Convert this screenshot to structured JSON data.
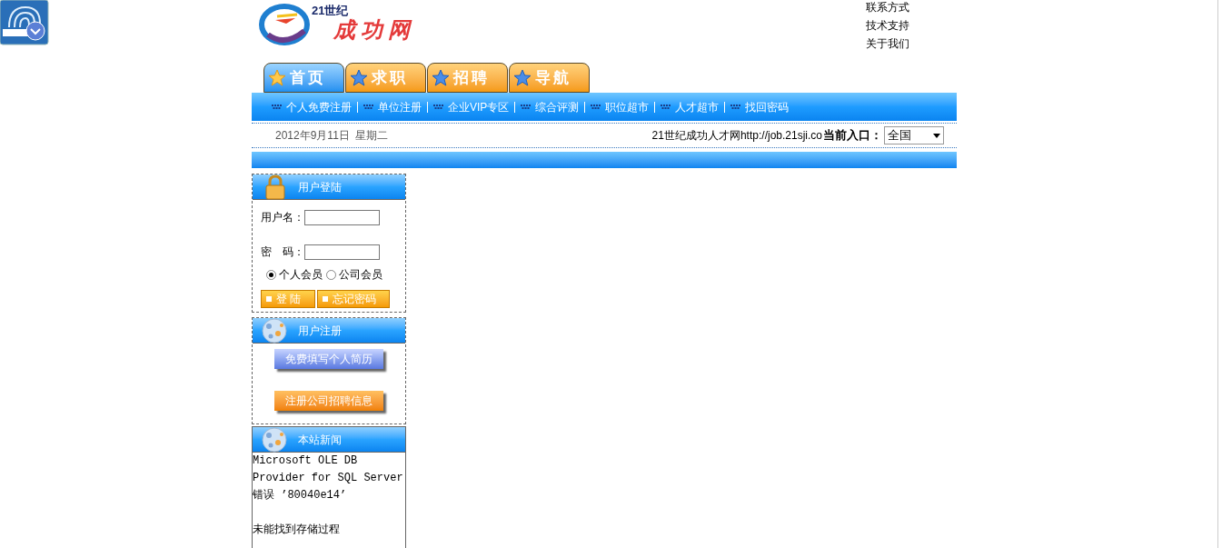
{
  "logo": {
    "top": "21世纪",
    "main": "成功网"
  },
  "header_links": [
    "联系方式",
    "技术支持",
    "关于我们"
  ],
  "tabs": [
    {
      "label": "首页",
      "selected": true
    },
    {
      "label": "求职",
      "selected": false
    },
    {
      "label": "招聘",
      "selected": false
    },
    {
      "label": "导航",
      "selected": false
    }
  ],
  "nav_links": [
    "个人免费注册",
    "单位注册",
    "企业VIP专区",
    "综合评测",
    "职位超市",
    "人才超市",
    "找回密码"
  ],
  "date": "2012年9月11日  星期二",
  "site": "21世纪成功人才网http://job.21sji.co",
  "entry": {
    "label": "当前入口：",
    "value": "全国"
  },
  "login": {
    "title": "用户登陆",
    "fields": [
      {
        "label": "用户名："
      },
      {
        "label": "密　码："
      }
    ],
    "member_types": [
      {
        "label": "个人会员",
        "selected": true
      },
      {
        "label": "公司会员",
        "selected": false
      }
    ],
    "buttons": [
      "登 陆",
      "忘记密码"
    ]
  },
  "register": {
    "title": "用户注册",
    "buttons": [
      {
        "label": "免费填写个人简历",
        "kind": "blue"
      },
      {
        "label": "注册公司招聘信息",
        "kind": "orange"
      }
    ]
  },
  "news": {
    "title": "本站新闻",
    "paragraphs": [
      [
        "Microsoft OLE DB",
        "Provider for SQL Server",
        "错误 ’80040e14’"
      ],
      [
        "未能找到存储过程"
      ]
    ]
  }
}
